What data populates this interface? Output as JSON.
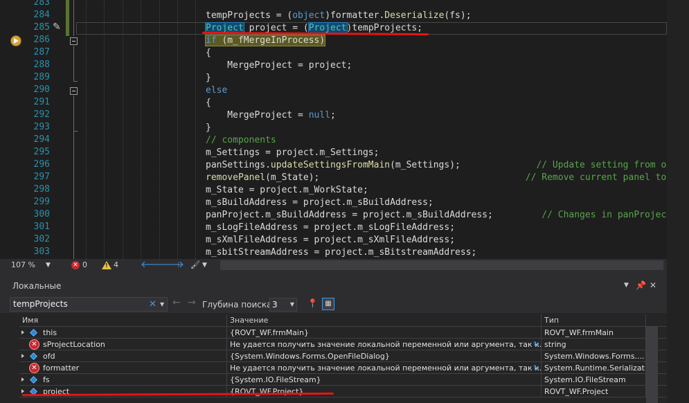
{
  "editor": {
    "lines": [
      {
        "n": "283",
        "html": ""
      },
      {
        "n": "284",
        "html": "tempProjects = (<span class='kw'>object</span>)formatter.<span class='fn'>Deserialize</span>(fs);"
      },
      {
        "n": "285",
        "html": "<span class='ty hl-ref'>Project</span> project = (<span class='ty hl-ref'>Project</span>)tempProjects;"
      },
      {
        "n": "286",
        "html": "<span class='hl-next'><span class='kw'>if</span> (m_fMergeInProcess)</span>"
      },
      {
        "n": "287",
        "html": "{"
      },
      {
        "n": "288",
        "html": "    MergeProject = project;"
      },
      {
        "n": "289",
        "html": "}"
      },
      {
        "n": "290",
        "html": "<span class='kw'>else</span>"
      },
      {
        "n": "291",
        "html": "{"
      },
      {
        "n": "292",
        "html": "    MergeProject = <span class='kw'>null</span>;"
      },
      {
        "n": "293",
        "html": "}"
      },
      {
        "n": "294",
        "html": "<span class='cm'>// components</span>"
      },
      {
        "n": "295",
        "html": "m_Settings = project.m_Settings;"
      },
      {
        "n": "296",
        "html": "panSettings.<span class='fn'>updateSettingsFromMain</span>(m_Settings);              <span class='cm'>// Update setting from open</span>"
      },
      {
        "n": "297",
        "html": "<span class='fn'>removePanel</span>(m_State);                                      <span class='cm'>// Remove current panel to</span>"
      },
      {
        "n": "298",
        "html": "m_State = project.m_WorkState;"
      },
      {
        "n": "299",
        "html": "m_sBuildAddress = project.m_sBuildAddress;"
      },
      {
        "n": "300",
        "html": "panProject.m_sBuildAddress = project.m_sBuildAddress;         <span class='cm'>// Changes in panProject t</span>"
      },
      {
        "n": "301",
        "html": "m_sLogFileAddress = project.m_sLogFileAddress;"
      },
      {
        "n": "302",
        "html": "m_sXmlFileAddress = project.m_sXmlFileAddress;"
      },
      {
        "n": "303",
        "html": "m_sbitStreamAddress = project.m_sBitstreamAddress;"
      }
    ]
  },
  "status": {
    "zoom": "107 %",
    "errors": "0",
    "warnings": "4"
  },
  "locals": {
    "title": "Локальные",
    "search_value": "tempProjects",
    "depth_label": "Глубина поиска:",
    "depth_value": "3",
    "columns": {
      "name": "Имя",
      "value": "Значение",
      "type": "Тип"
    },
    "rows": [
      {
        "name": "this",
        "value": "{ROVT_WF.frmMain}",
        "type": "ROVT_WF.frmMain",
        "icon": "cube-icon",
        "expandable": true,
        "refresh": false
      },
      {
        "name": "sProjectLocation",
        "value": "Не удается получить значение локальной переменной или аргумента, так к...",
        "type": "string",
        "icon": "error-icon",
        "expandable": false,
        "refresh": true
      },
      {
        "name": "ofd",
        "value": "{System.Windows.Forms.OpenFileDialog}",
        "type": "System.Windows.Forms....",
        "icon": "cube-icon",
        "expandable": true,
        "refresh": false
      },
      {
        "name": "formatter",
        "value": "Не удается получить значение локальной переменной или аргумента, так к...",
        "type": "System.Runtime.Serializat...",
        "icon": "error-icon",
        "expandable": false,
        "refresh": true
      },
      {
        "name": "fs",
        "value": "{System.IO.FileStream}",
        "type": "System.IO.FileStream",
        "icon": "cube-icon",
        "expandable": true,
        "refresh": false
      },
      {
        "name": "project",
        "value": "{ROVT_WF.Project}",
        "type": "ROVT_WF.Project",
        "icon": "cube-icon",
        "expandable": true,
        "refresh": false
      }
    ]
  },
  "colors": {
    "background": "#1e1e1e",
    "keyword": "#569cd6",
    "type": "#4ec9b0",
    "comment": "#57a64a",
    "line_number": "#2b91af",
    "annotation_red": "#e51515"
  }
}
